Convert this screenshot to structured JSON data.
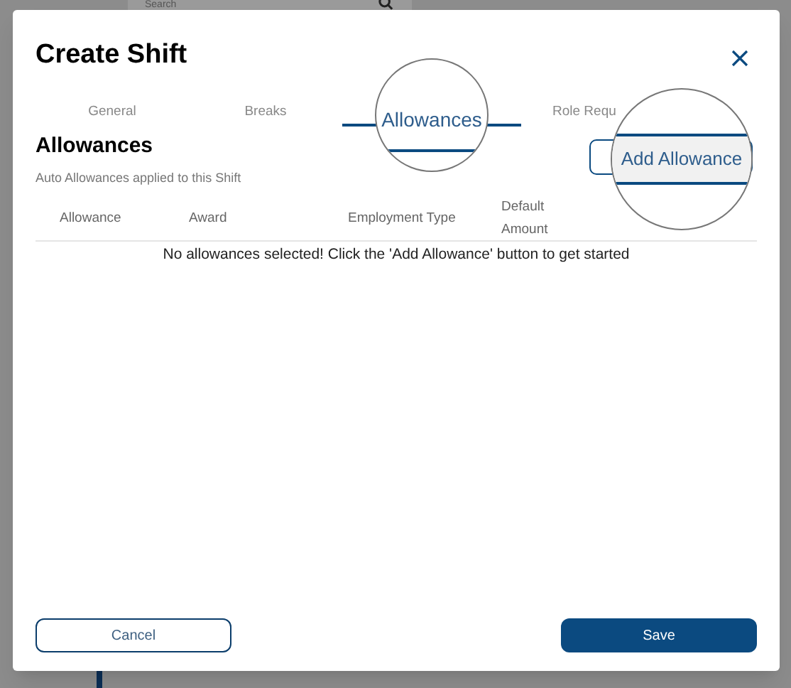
{
  "background": {
    "search": {
      "placeholder": "Search"
    }
  },
  "dialog": {
    "title": "Create Shift",
    "tabs": [
      {
        "label": "General",
        "selected": false
      },
      {
        "label": "Breaks",
        "selected": false
      },
      {
        "label": "Allowances",
        "selected": true
      },
      {
        "label": "Role Requ",
        "selected": false
      }
    ],
    "section": {
      "heading": "Allowances",
      "subtitle": "Auto Allowances applied to this Shift",
      "add_button": "Add Allowance"
    },
    "table": {
      "columns": [
        "Allowance",
        "Award",
        "Employment Type",
        "Default Amount"
      ],
      "empty_message": "No allowances selected! Click the 'Add Allowance' button to get started"
    },
    "buttons": {
      "cancel": "Cancel",
      "save": "Save"
    }
  }
}
